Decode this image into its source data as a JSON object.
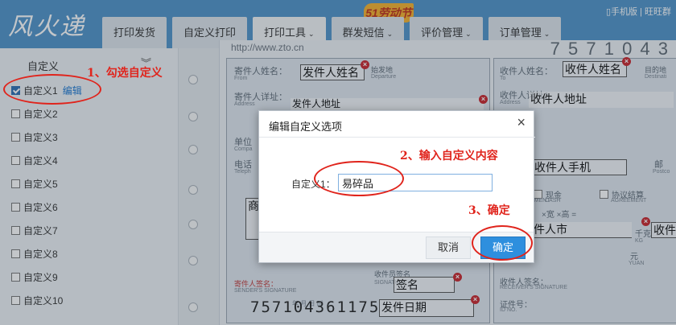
{
  "header": {
    "logo": "风火递",
    "badge": "51劳动节",
    "top_links": "手机版 | 旺旺群",
    "tabs": [
      {
        "label": "打印发货",
        "caret": ""
      },
      {
        "label": "自定义打印",
        "caret": ""
      },
      {
        "label": "打印工具",
        "caret": "⌄"
      },
      {
        "label": "群发短信",
        "caret": "⌄"
      },
      {
        "label": "评价管理",
        "caret": "⌄"
      },
      {
        "label": "订单管理",
        "caret": "⌄"
      }
    ]
  },
  "sidebar": {
    "title": "自定义",
    "collapse_icon": "double-chevron-down",
    "edit_label": "编辑",
    "items": [
      {
        "label": "自定义1",
        "checked": true
      },
      {
        "label": "自定义2",
        "checked": false
      },
      {
        "label": "自定义3",
        "checked": false
      },
      {
        "label": "自定义4",
        "checked": false
      },
      {
        "label": "自定义5",
        "checked": false
      },
      {
        "label": "自定义6",
        "checked": false
      },
      {
        "label": "自定义7",
        "checked": false
      },
      {
        "label": "自定义8",
        "checked": false
      },
      {
        "label": "自定义9",
        "checked": false
      },
      {
        "label": "自定义10",
        "checked": false
      }
    ]
  },
  "annotations": {
    "step1": "1、勾选自定义",
    "step2": "2、输入自定义内容",
    "step3": "3、确定"
  },
  "waybill": {
    "url": "http://www.zto.cn",
    "top_number": "7 5 7 1 0 4 3",
    "sender_name_label": "寄件人姓名：",
    "sender_name_label_en": "From",
    "origin_label": "始发地",
    "origin_label_en": "Departure",
    "sender_address_label": "寄件人详址：",
    "sender_address_label_en": "Address",
    "unit_label": "单位",
    "unit_label_en": "Compa",
    "phone_label": "电话",
    "phone_label_en": "Teleph",
    "recipient_name_label": "收件人姓名：",
    "recipient_name_label_en": "To",
    "destination_label": "目的地",
    "destination_label_en": "Destinati",
    "recipient_address_label": "收件人详址：",
    "recipient_address_label_en": "Address",
    "postcode_label": "邮",
    "postcode_label_en": "Postco",
    "cash_label": "现金",
    "cash_label_en": "CASH",
    "agreement_label": "协议结算",
    "agreement_label_en": "AGREEMENT",
    "payment_label_en": "YMENT",
    "dimensions_label": "×宽  ×高  =",
    "weight_label": "千克",
    "weight_label_en": "KG",
    "yuan_label": "元",
    "yuan_label_en": "YUAN",
    "sender_sign_label": "寄件人签名：",
    "sender_sign_label_en": "SENDER'S SIGNATURE",
    "date_marks": "年  月  日  时",
    "receiver_sign_label": "收件员签名",
    "receiver_sign_label_en": "SIGNATURE",
    "recipient_sign_label": "收件人签名：",
    "recipient_sign_label_en": "RECEIVER'S SIGNATURE",
    "id_label": "证件号：",
    "id_label_en": "ID NO.",
    "barcode_number": "757104361175",
    "fields": {
      "sender_name": "发件人姓名",
      "sender_address": "发件人地址",
      "recipient_name": "收件人姓名",
      "recipient_address": "收件人地址",
      "recipient_phone": "收件人手机",
      "recipient_city": "件人市",
      "recipient_district": "收件",
      "product": "商",
      "signature": "签名",
      "send_date": "发件日期"
    }
  },
  "dialog": {
    "title": "编辑自定义选项",
    "field_label": "自定义1：",
    "field_value": "易碎品",
    "cancel_label": "取消",
    "ok_label": "确定"
  }
}
